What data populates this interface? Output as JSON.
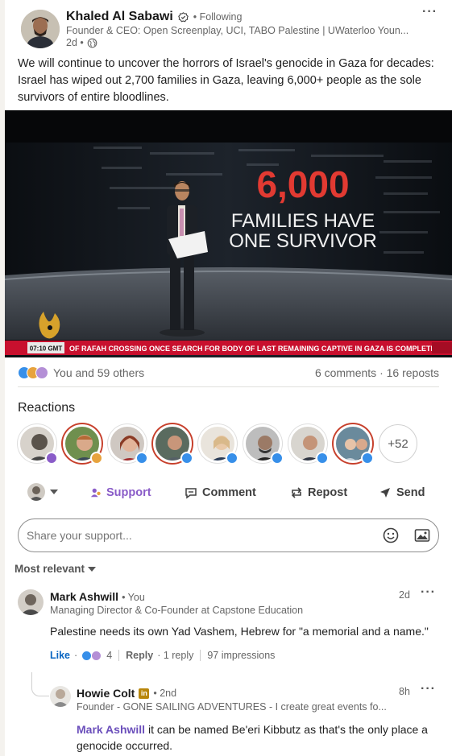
{
  "post": {
    "author_name": "Khaled Al Sabawi",
    "following": "• Following",
    "headline": "Founder & CEO: Open Screenplay, UCI, TABO Palestine | UWaterloo Youn...",
    "time": "2d •",
    "text": "We will continue to uncover the horrors of Israel's genocide in Gaza for decades: Israel has wiped out 2,700 families in Gaza, leaving 6,000+ people as the sole survivors of entire bloodlines.",
    "more_label": "···"
  },
  "media": {
    "big_number": "6,000",
    "line1": "FAMILIES HAVE",
    "line2": "ONE SURVIVOR",
    "clock": "07:10 GMT",
    "ticker": "OF RAFAH CROSSING ONCE SEARCH FOR BODY OF LAST REMAINING CAPTIVE IN GAZA IS COMPLETE"
  },
  "social": {
    "reactions_text": "You and 59 others",
    "comments_reposts": "6 comments · 16 reposts"
  },
  "reactions": {
    "title": "Reactions",
    "more_count": "+52"
  },
  "actions": {
    "support": "Support",
    "comment": "Comment",
    "repost": "Repost",
    "send": "Send"
  },
  "composer": {
    "placeholder": "Share your support..."
  },
  "sort": {
    "label": "Most relevant"
  },
  "comments": [
    {
      "name": "Mark Ashwill",
      "you": "• You",
      "headline": "Managing Director & Co-Founder at Capstone Education",
      "time": "2d",
      "text": "Palestine needs its own Yad Vashem, Hebrew for \"a memorial and a name.\"",
      "like": "Like",
      "like_sep": "·",
      "like_count": "4",
      "reply": "Reply",
      "reply_count": "· 1 reply",
      "impressions": "97 impressions"
    }
  ],
  "reply": {
    "name": "Howie Colt",
    "degree": "• 2nd",
    "headline": "Founder - GONE SAILING ADVENTURES - I create great events fo...",
    "time": "8h",
    "mention": "Mark Ashwill",
    "text": " it can be named Be'eri Kibbutz as that's the only place a genocide occurred."
  },
  "colors": {
    "accent_blue": "#0a66c2",
    "support_purple": "#8a5cc8",
    "news_red": "#c8102e"
  }
}
